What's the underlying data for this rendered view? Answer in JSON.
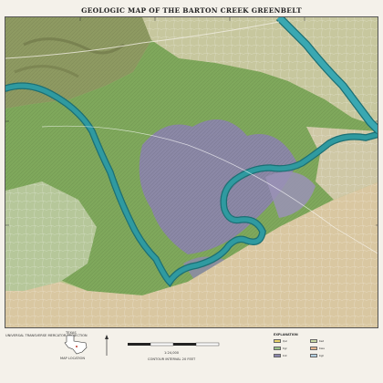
{
  "map": {
    "title": "GEOLOGIC MAP OF THE BARTON CREEK GREENBELT",
    "colors": {
      "paper": "#f4f1ea",
      "river": "#2f9aa0",
      "river_edge": "#1c6f74",
      "upland_green": "#9cb878",
      "forest": "#6f9a52",
      "limestone_purple": "#8c86ad",
      "urban_tan": "#d9c7a1"
    },
    "legend": {
      "heading": "EXPLANATION",
      "units": [
        {
          "label": "Qal",
          "color": "#e8d36a"
        },
        {
          "label": "Kgr",
          "color": "#9cc38a"
        },
        {
          "label": "Kdr",
          "color": "#8c86ad"
        },
        {
          "label": "Ked",
          "color": "#c9d9a4"
        },
        {
          "label": "Kwa",
          "color": "#e3b58e"
        },
        {
          "label": "Kgt",
          "color": "#b2cfe0"
        }
      ]
    },
    "map_notes": {
      "location_label": "MAP LOCATION",
      "state_label": "TEXAS",
      "scale_label": "1:24,000",
      "projection_note": "UNIVERSAL TRANSVERSE MERCATOR PROJECTION",
      "contour_note": "CONTOUR INTERVAL 20 FEET"
    }
  }
}
